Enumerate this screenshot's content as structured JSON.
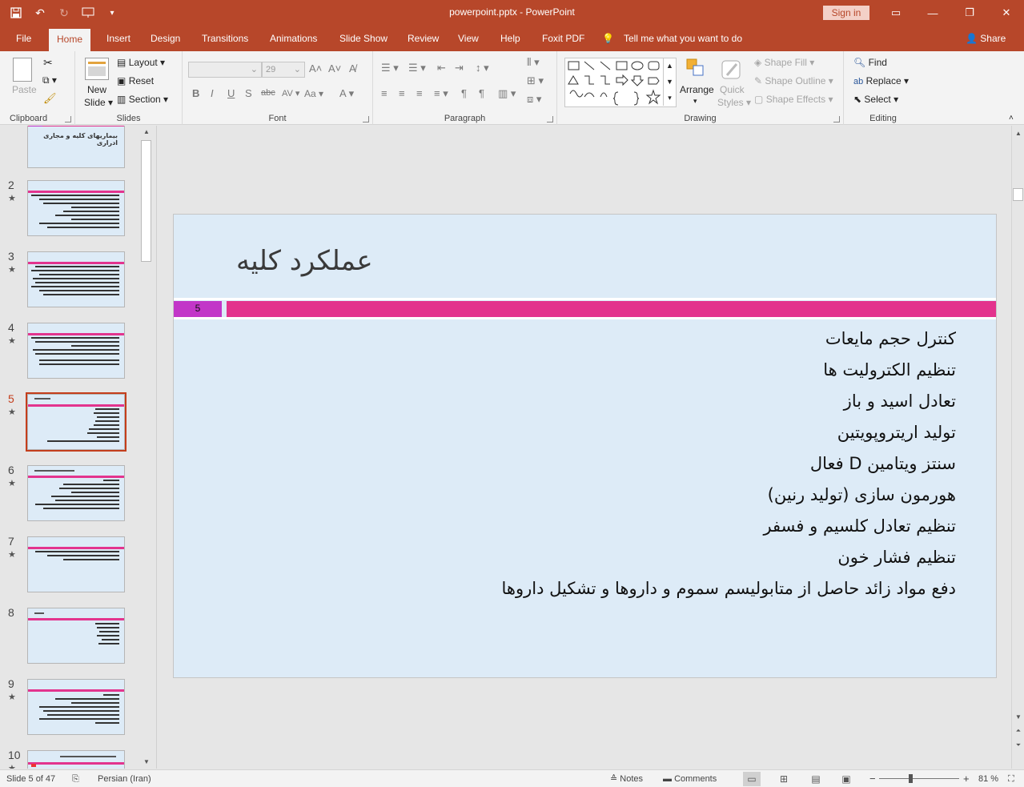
{
  "window": {
    "title": "powerpoint.pptx  -  PowerPoint",
    "sign_in": "Sign in"
  },
  "tabs": [
    "File",
    "Home",
    "Insert",
    "Design",
    "Transitions",
    "Animations",
    "Slide Show",
    "Review",
    "View",
    "Help",
    "Foxit PDF"
  ],
  "active_tab": "Home",
  "tell_me": "Tell me what you want to do",
  "share": "Share",
  "ribbon": {
    "clipboard": {
      "label": "Clipboard",
      "paste": "Paste"
    },
    "slides": {
      "label": "Slides",
      "new_slide_1": "New",
      "new_slide_2": "Slide",
      "layout": "Layout",
      "reset": "Reset",
      "section": "Section"
    },
    "font": {
      "label": "Font",
      "font_name": "",
      "font_size": "29"
    },
    "paragraph": {
      "label": "Paragraph"
    },
    "drawing": {
      "label": "Drawing",
      "arrange": "Arrange",
      "quick_styles_1": "Quick",
      "quick_styles_2": "Styles",
      "shape_fill": "Shape Fill",
      "shape_outline": "Shape Outline",
      "shape_effects": "Shape Effects"
    },
    "editing": {
      "label": "Editing",
      "find": "Find",
      "replace": "Replace",
      "select": "Select"
    }
  },
  "thumbnails": [
    {
      "num": "",
      "title": "بیماریهای کلیه و مجاری ادراری"
    },
    {
      "num": "2"
    },
    {
      "num": "3"
    },
    {
      "num": "4"
    },
    {
      "num": "5",
      "current": true
    },
    {
      "num": "6"
    },
    {
      "num": "7"
    },
    {
      "num": "8"
    },
    {
      "num": "9"
    },
    {
      "num": "10"
    }
  ],
  "slide": {
    "title": "عملکرد کلیه",
    "number": "5",
    "bullets": [
      "کنترل حجم مایعات",
      "تنظیم الکترولیت ها",
      "تعادل اسید و باز",
      "تولید اریتروپویتین",
      "سنتز ویتامین D فعال",
      "هورمون سازی (تولید رنین)",
      "تنظیم تعادل کلسیم و فسفر",
      "تنظیم فشار خون",
      "دفع مواد زائد حاصل از متابولیسم سموم و داروها و تشکیل داروها"
    ]
  },
  "status": {
    "slide_of": "Slide 5 of 47",
    "language": "Persian (Iran)",
    "notes": "Notes",
    "comments": "Comments",
    "zoom": "81 %"
  },
  "colors": {
    "accent": "#b7472a",
    "slide_bg": "#ddebf7",
    "pink_bar": "#e3338d",
    "number_box": "#c236c8"
  }
}
